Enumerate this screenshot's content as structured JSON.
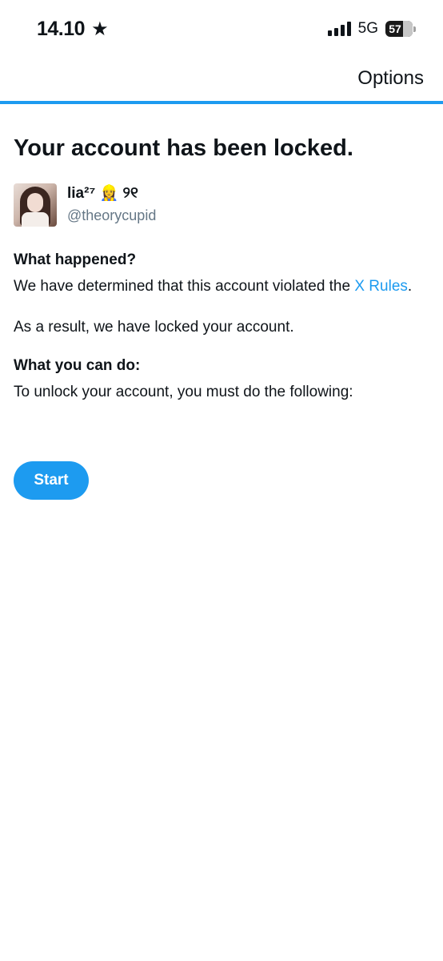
{
  "status_bar": {
    "time": "14.10",
    "star_icon": "star-icon",
    "network": "5G",
    "battery": "57"
  },
  "topbar": {
    "options_label": "Options"
  },
  "colors": {
    "accent": "#1d9bf0",
    "text": "#0f1419",
    "muted": "#657786"
  },
  "main": {
    "title": "Your account has been locked.",
    "user": {
      "display_name": "lia²⁷ 👷‍♀️ ୨୧",
      "username": "@theorycupid"
    },
    "what_happened": {
      "heading": "What happened?",
      "text_before_link": "We have determined that this account violated the ",
      "link_text": "X Rules",
      "text_after_link": ".",
      "result_text": "As a result, we have locked your account."
    },
    "what_you_can_do": {
      "heading": "What you can do:",
      "text": "To unlock your account, you must do the following:"
    },
    "start_label": "Start"
  }
}
